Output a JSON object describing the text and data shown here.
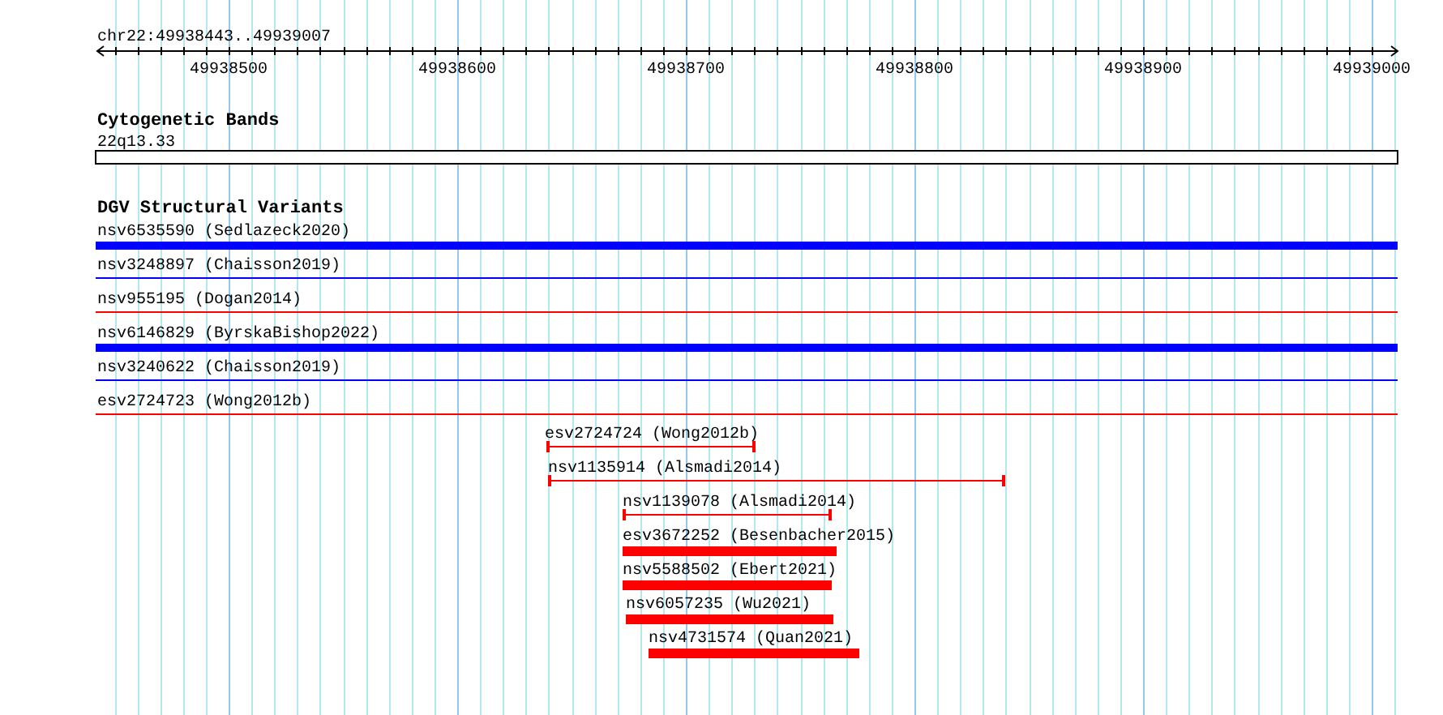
{
  "ruler": {
    "region": "chr22:49938443..49939007",
    "ticks": [
      "49938500",
      "49938600",
      "49938700",
      "49938800",
      "49938900",
      "49939000"
    ]
  },
  "cytogenetic_bands": {
    "title": "Cytogenetic Bands",
    "band": "22q13.33"
  },
  "dgv_track": {
    "title": "DGV Structural Variants",
    "variants": [
      {
        "label": "nsv6535590 (Sedlazeck2020)",
        "kind": "thick",
        "color": "#0000ff"
      },
      {
        "label": "nsv3248897 (Chaisson2019)",
        "kind": "thin",
        "color": "#0000ff"
      },
      {
        "label": "nsv955195 (Dogan2014)",
        "kind": "thin",
        "color": "#ff0000"
      },
      {
        "label": "nsv6146829 (ByrskaBishop2022)",
        "kind": "thick",
        "color": "#0000ff"
      },
      {
        "label": "nsv3240622 (Chaisson2019)",
        "kind": "thin",
        "color": "#0000ff"
      },
      {
        "label": "esv2724723 (Wong2012b)",
        "kind": "thin",
        "color": "#ff0000"
      },
      {
        "label": "esv2724724 (Wong2012b)",
        "kind": "capped",
        "color": "#ff0000"
      },
      {
        "label": "nsv1135914 (Alsmadi2014)",
        "kind": "capped",
        "color": "#ff0000"
      },
      {
        "label": "nsv1139078 (Alsmadi2014)",
        "kind": "capped",
        "color": "#ff0000"
      },
      {
        "label": "esv3672252 (Besenbacher2015)",
        "kind": "thick",
        "color": "#ff0000"
      },
      {
        "label": "nsv5588502 (Ebert2021)",
        "kind": "thick",
        "color": "#ff0000"
      },
      {
        "label": "nsv6057235 (Wu2021)",
        "kind": "thick",
        "color": "#ff0000"
      },
      {
        "label": "nsv4731574 (Quan2021)",
        "kind": "thick",
        "color": "#ff0000"
      }
    ]
  }
}
